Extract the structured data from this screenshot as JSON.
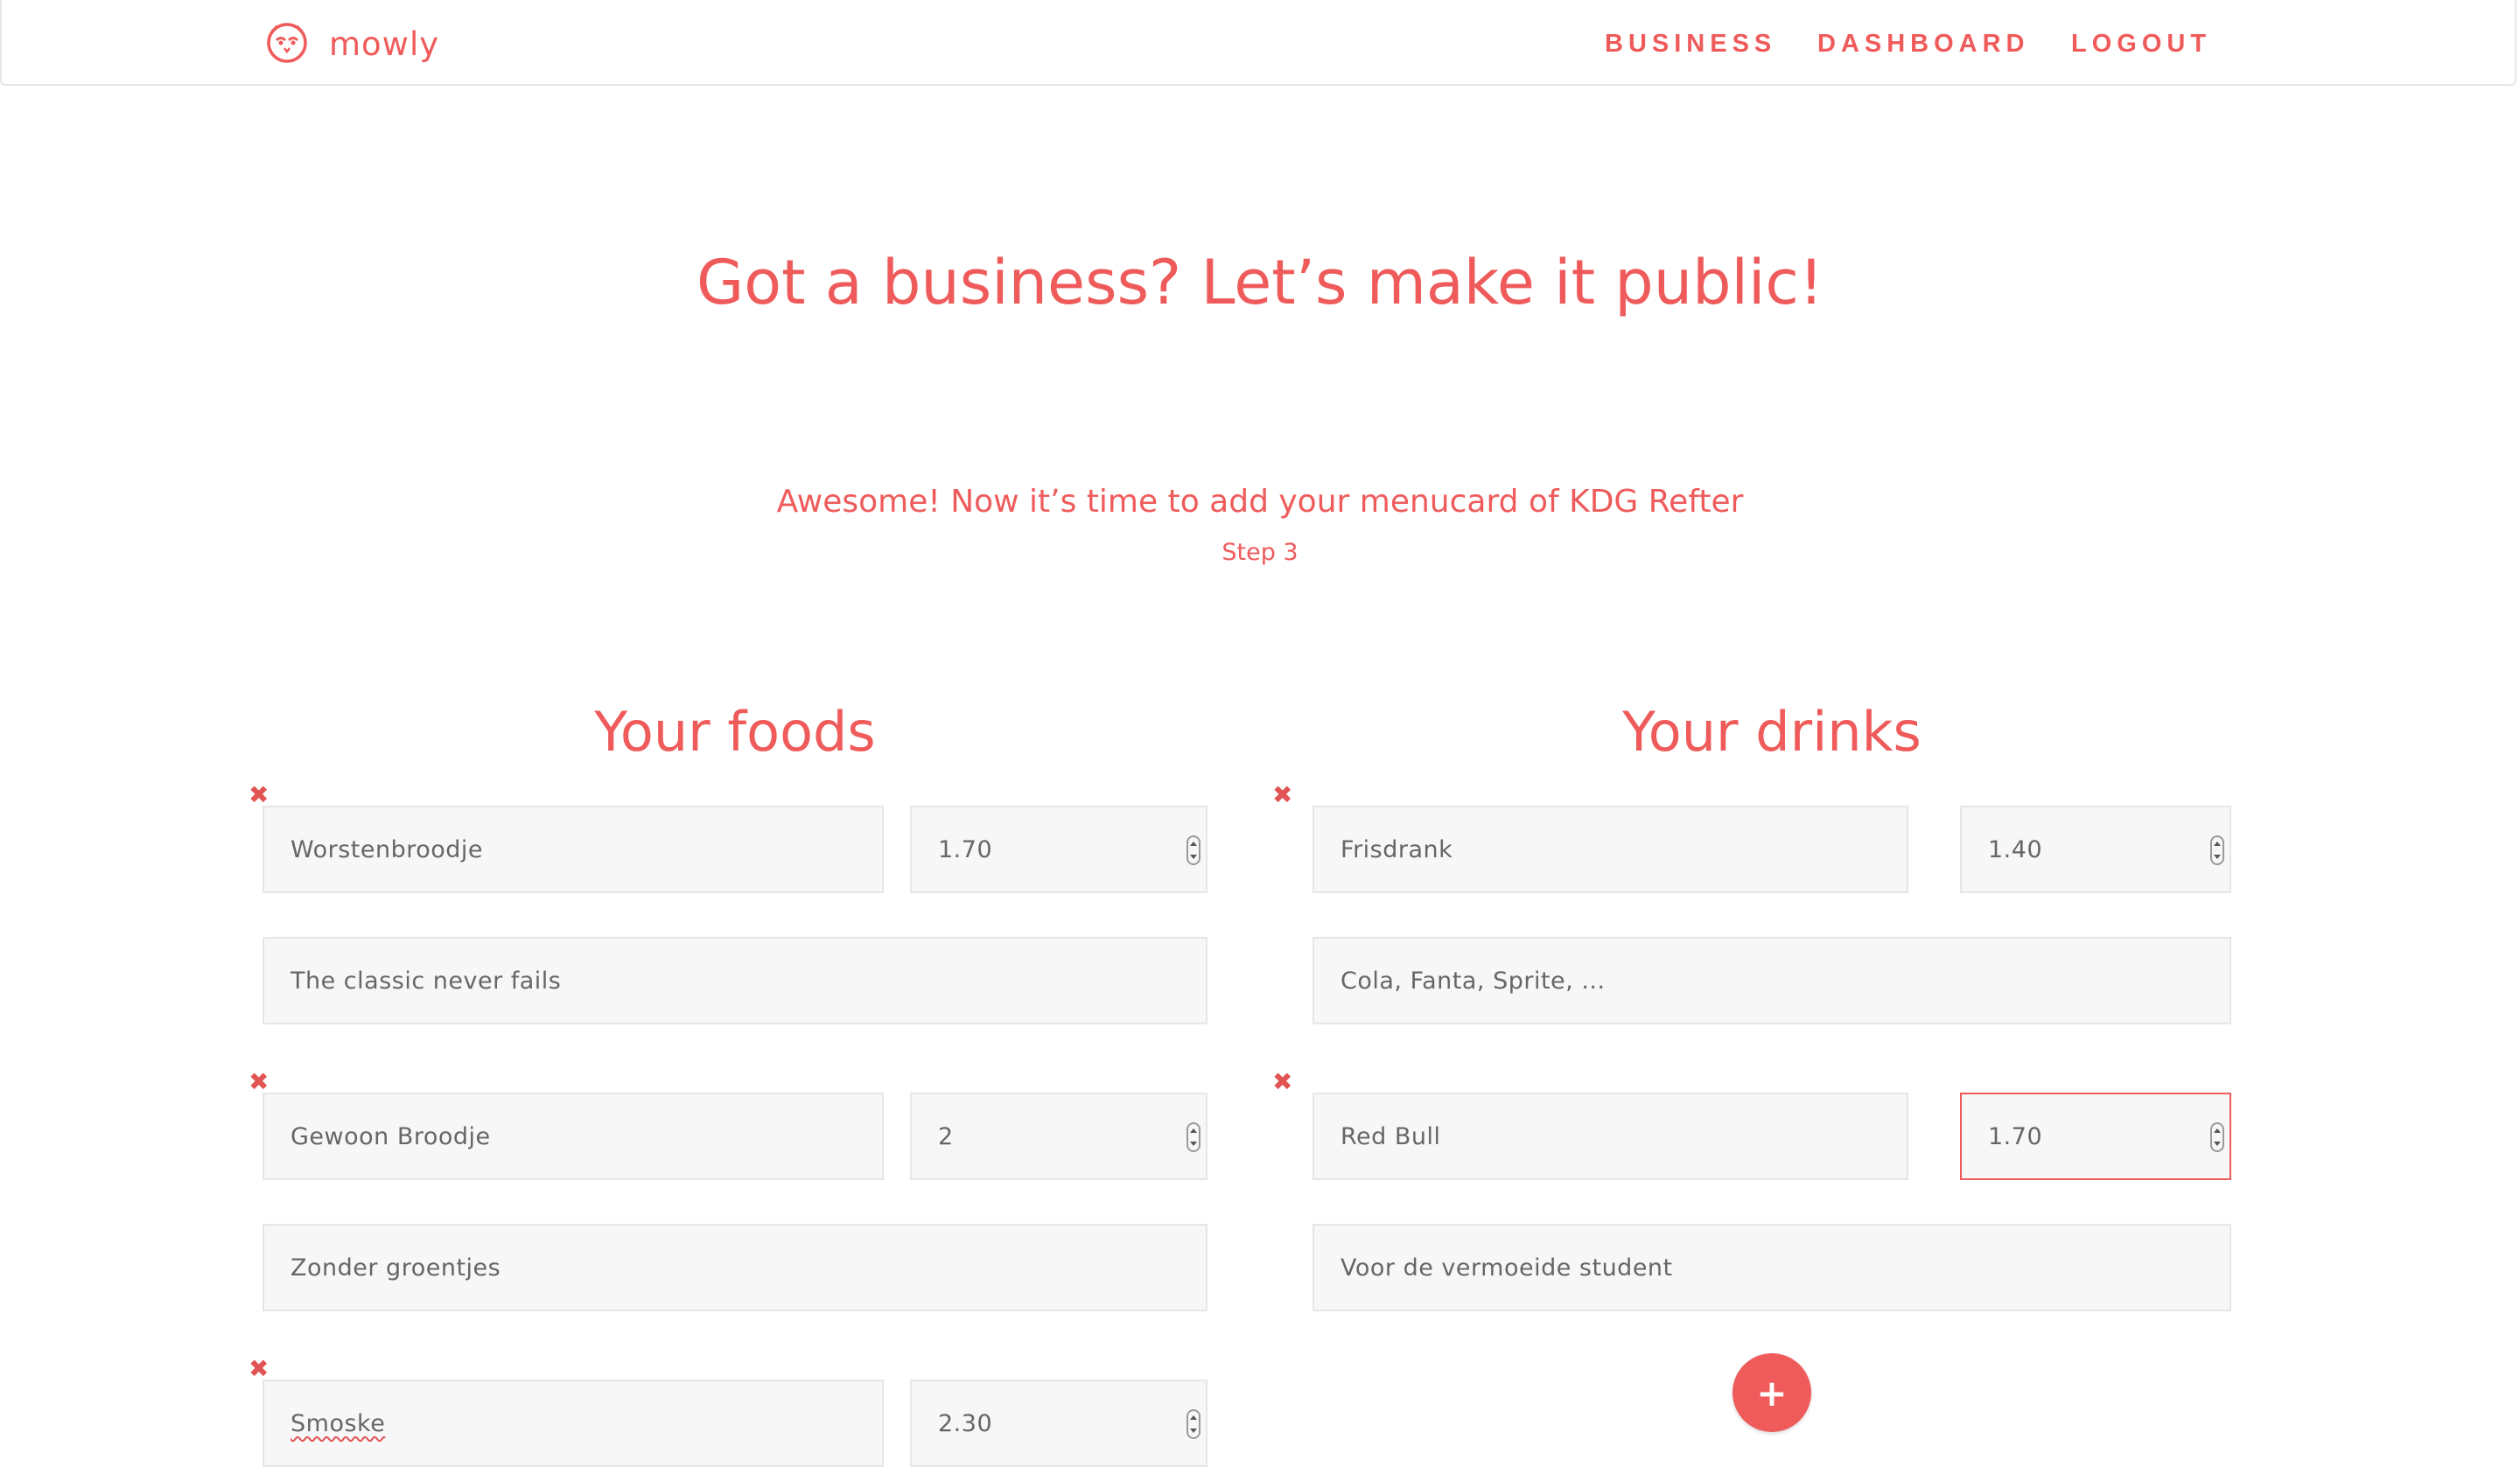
{
  "brand": {
    "name": "mowly",
    "logo_icon": "owl-icon"
  },
  "nav": {
    "items": [
      {
        "label": "BUSINESS"
      },
      {
        "label": "DASHBOARD"
      },
      {
        "label": "LOGOUT"
      }
    ]
  },
  "hero": {
    "title": "Got a business? Let’s make it public!"
  },
  "intro": {
    "subtitle": "Awesome! Now it’s time to add your menucard of KDG Refter",
    "step": "Step 3"
  },
  "foods": {
    "title": "Your foods",
    "items": [
      {
        "name": "Worstenbroodje",
        "price": "1.70",
        "description": "The classic never fails"
      },
      {
        "name": "Gewoon Broodje",
        "price": "2",
        "description": "Zonder groentjes"
      },
      {
        "name": "Smoske",
        "price": "2.30"
      }
    ]
  },
  "drinks": {
    "title": "Your drinks",
    "items": [
      {
        "name": "Frisdrank",
        "price": "1.40",
        "description": "Cola, Fanta, Sprite, ..."
      },
      {
        "name": "Red Bull",
        "price": "1.70",
        "description": "Voor de vermoeide student"
      }
    ]
  },
  "icons": {
    "remove": "✖",
    "add": "+"
  },
  "colors": {
    "accent": "#ef5b5b",
    "field_bg": "#f7f7f7",
    "field_border": "#e6e6e6"
  }
}
